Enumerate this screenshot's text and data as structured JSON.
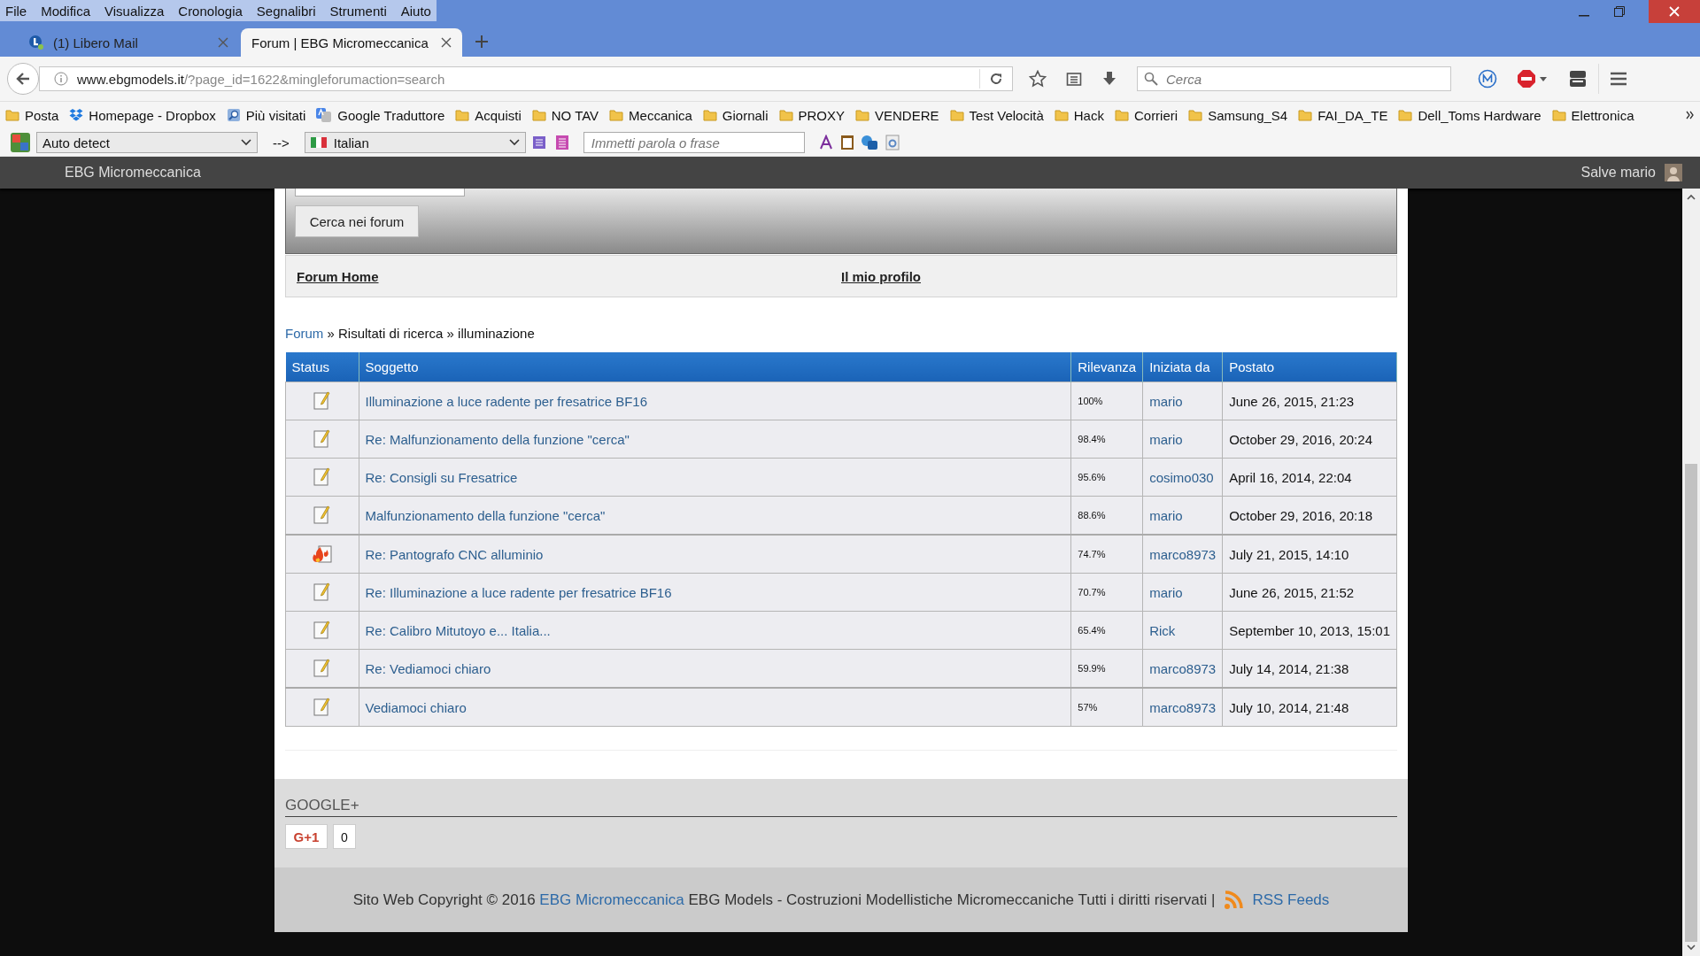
{
  "menu_bar": [
    "File",
    "Modifica",
    "Visualizza",
    "Cronologia",
    "Segnalibri",
    "Strumenti",
    "Aiuto"
  ],
  "tabs": [
    {
      "title": "(1) Libero Mail",
      "selected": false
    },
    {
      "title": "Forum | EBG Micromeccanica",
      "selected": true
    }
  ],
  "address_bar": {
    "domain": "www.ebgmodels.it",
    "path": "/?page_id=1622&mingleforumaction=search"
  },
  "search": {
    "placeholder": "Cerca"
  },
  "bookmarks": [
    {
      "label": "Posta",
      "kind": "folder"
    },
    {
      "label": "Homepage - Dropbox",
      "kind": "dropbox"
    },
    {
      "label": "Più visitati",
      "kind": "search"
    },
    {
      "label": "Google Traduttore",
      "kind": "translate"
    },
    {
      "label": "Acquisti",
      "kind": "folder"
    },
    {
      "label": "NO TAV",
      "kind": "folder"
    },
    {
      "label": "Meccanica",
      "kind": "folder"
    },
    {
      "label": "Giornali",
      "kind": "folder"
    },
    {
      "label": "PROXY",
      "kind": "folder"
    },
    {
      "label": "VENDERE",
      "kind": "folder"
    },
    {
      "label": "Test Velocità",
      "kind": "folder"
    },
    {
      "label": "Hack",
      "kind": "folder"
    },
    {
      "label": "Corrieri",
      "kind": "folder"
    },
    {
      "label": "Samsung_S4",
      "kind": "folder"
    },
    {
      "label": "FAI_DA_TE",
      "kind": "folder"
    },
    {
      "label": "Dell_Toms Hardware",
      "kind": "folder"
    },
    {
      "label": "Elettronica",
      "kind": "folder"
    }
  ],
  "translator": {
    "source": "Auto detect",
    "arrow": "-->",
    "target": "Italian",
    "placeholder": "Immetti parola o frase"
  },
  "site_bar": {
    "title": "EBG Micromeccanica",
    "greeting": "Salve mario"
  },
  "search_button": "Cerca nei forum",
  "forum_links": [
    "Forum Home",
    "Il mio profilo"
  ],
  "breadcrumb": {
    "link": "Forum",
    "trail": "» Risultati di ricerca » illuminazione"
  },
  "table": {
    "columns": [
      "Status",
      "Soggetto",
      "Rilevanza",
      "Iniziata da",
      "Postato"
    ],
    "rows": [
      {
        "kind": "topic",
        "subject": "Illuminazione a luce radente per fresatrice BF16",
        "relevance": "100%",
        "author": "mario",
        "posted": "June 26, 2015, 21:23"
      },
      {
        "kind": "topic",
        "subject": "Re: Malfunzionamento della funzione \"cerca\"",
        "relevance": "98.4%",
        "author": "mario",
        "posted": "October 29, 2016, 20:24"
      },
      {
        "kind": "topic",
        "subject": "Re: Consigli su Fresatrice",
        "relevance": "95.6%",
        "author": "cosimo030",
        "posted": "April 16, 2014, 22:04"
      },
      {
        "kind": "topic",
        "subject": "Malfunzionamento della funzione \"cerca\"",
        "relevance": "88.6%",
        "author": "mario",
        "posted": "October 29, 2016, 20:18"
      },
      {
        "kind": "hot",
        "subject": "Re: Pantografo CNC alluminio",
        "relevance": "74.7%",
        "author": "marco8973",
        "posted": "July 21, 2015, 14:10"
      },
      {
        "kind": "topic",
        "subject": "Re: Illuminazione a luce radente per fresatrice BF16",
        "relevance": "70.7%",
        "author": "mario",
        "posted": "June 26, 2015, 21:52"
      },
      {
        "kind": "topic",
        "subject": "Re: Calibro Mitutoyo e... Italia...",
        "relevance": "65.4%",
        "author": "Rick",
        "posted": "September 10, 2013, 15:01"
      },
      {
        "kind": "topic",
        "subject": "Re: Vediamoci chiaro",
        "relevance": "59.9%",
        "author": "marco8973",
        "posted": "July 14, 2014, 21:38"
      },
      {
        "kind": "topic",
        "subject": "Vediamoci chiaro",
        "relevance": "57%",
        "author": "marco8973",
        "posted": "July 10, 2014, 21:48"
      }
    ]
  },
  "google_plus": {
    "title": "GOOGLE+",
    "button": "G+1",
    "count": "0"
  },
  "footer": {
    "prefix": "Sito Web Copyright © 2016",
    "link": "EBG Micromeccanica",
    "text": "EBG Models - Costruzioni Modellistiche Micromeccaniche Tutti i diritti riservati |",
    "rss": "RSS Feeds"
  }
}
